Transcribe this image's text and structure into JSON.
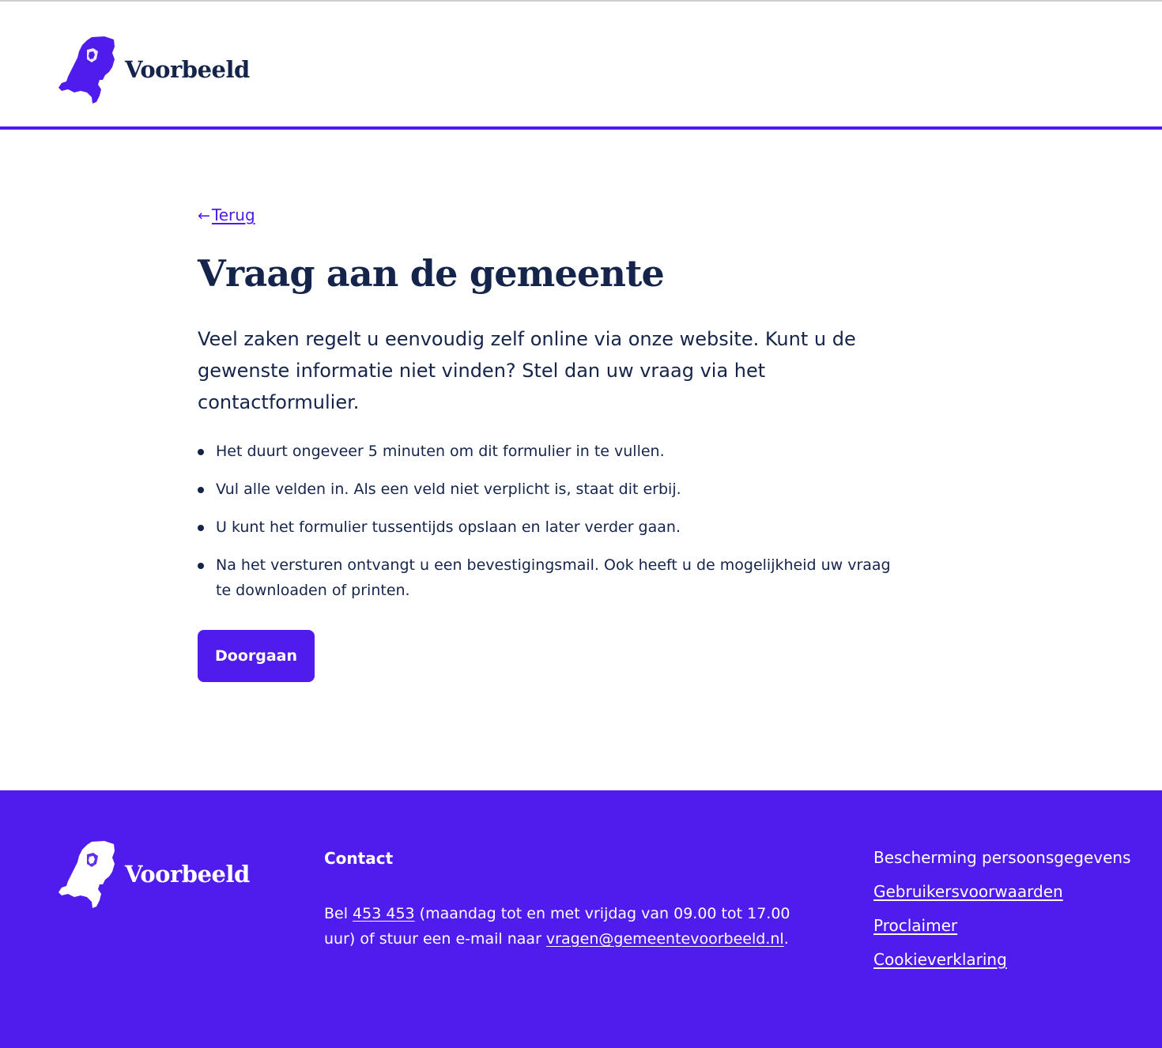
{
  "brand": {
    "name": "Voorbeeld",
    "accent_color": "#4f1ced",
    "text_color": "#15244a"
  },
  "header": {
    "logo_icon": "netherlands-map-icon",
    "logo_text": "Voorbeeld"
  },
  "main": {
    "back_arrow": "←",
    "back_label": "Terug",
    "title": "Vraag aan de gemeente",
    "intro": "Veel zaken regelt u eenvoudig zelf online via onze website. Kunt u de gewenste informatie niet vinden? Stel dan uw vraag via het contactformulier.",
    "bullets": [
      "Het duurt ongeveer 5 minuten om dit formulier in te vullen.",
      "Vul alle velden in. Als een veld niet verplicht is, staat dit erbij.",
      "U kunt het formulier tussentijds opslaan en later verder gaan.",
      "Na het versturen ontvangt u een bevestigingsmail. Ook heeft u de mogelijkheid uw vraag te downloaden of printen."
    ],
    "button_label": "Doorgaan"
  },
  "footer": {
    "logo_text": "Voorbeeld",
    "contact_heading": "Contact",
    "contact_prefix": "Bel ",
    "phone": "453 453",
    "contact_middle": " (maandag tot en met vrijdag van 09.00 tot 17.00 uur) of stuur een e-mail naar ",
    "email": "vragen@gemeentevoorbeeld.nl",
    "contact_suffix": ".",
    "links": [
      "Bescherming persoonsgegevens",
      "Gebruikersvoorwaarden",
      "Proclaimer",
      "Cookieverklaring"
    ]
  }
}
